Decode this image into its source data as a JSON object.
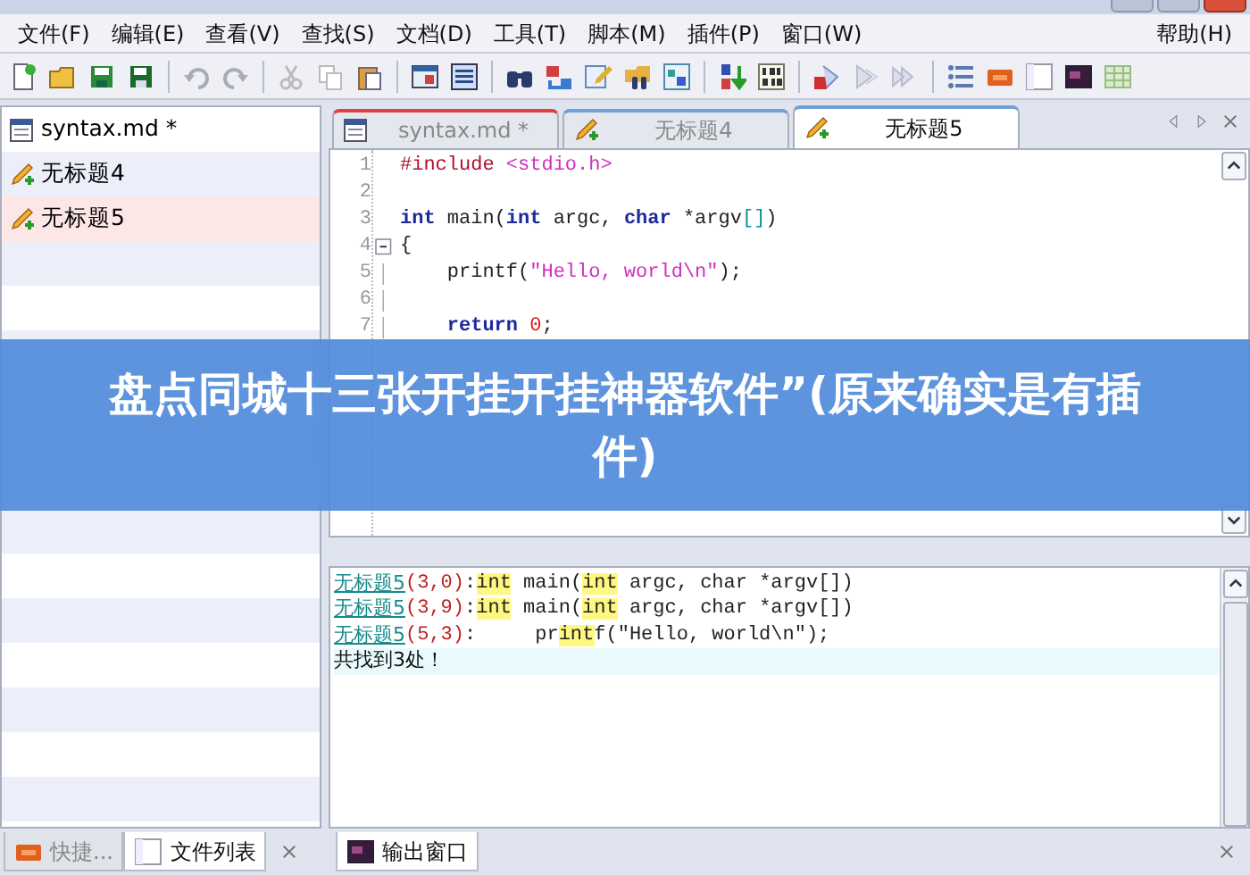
{
  "menu": [
    {
      "label": "文件(F)"
    },
    {
      "label": "编辑(E)"
    },
    {
      "label": "查看(V)"
    },
    {
      "label": "查找(S)"
    },
    {
      "label": "文档(D)"
    },
    {
      "label": "工具(T)"
    },
    {
      "label": "脚本(M)"
    },
    {
      "label": "插件(P)"
    },
    {
      "label": "窗口(W)"
    },
    {
      "label": "帮助(H)",
      "kind": "right"
    }
  ],
  "file_list": [
    {
      "label": "syntax.md *",
      "kind": "doc",
      "selected": false
    },
    {
      "label": "无标题4",
      "kind": "new",
      "selected": false
    },
    {
      "label": "无标题5",
      "kind": "new",
      "selected": true
    }
  ],
  "tabs": [
    {
      "label": "syntax.md *",
      "kind": "doc",
      "selected": false
    },
    {
      "label": "无标题4",
      "kind": "new",
      "selected": false
    },
    {
      "label": "无标题5",
      "kind": "new",
      "selected": true
    }
  ],
  "code_lines": [
    {
      "number": "1",
      "segments": [
        {
          "text": "#include ",
          "kind": "preproc"
        },
        {
          "text": "<stdio.h>",
          "kind": "string"
        }
      ]
    },
    {
      "number": "2"
    },
    {
      "number": "3",
      "segments": [
        {
          "text": "int",
          "kind": "keyword"
        },
        {
          "text": " main(",
          "kind": "plain"
        },
        {
          "text": "int",
          "kind": "keyword"
        },
        {
          "text": " argc, ",
          "kind": "plain"
        },
        {
          "text": "char",
          "kind": "keyword"
        },
        {
          "text": " *argv",
          "kind": "plain"
        },
        {
          "text": "[]",
          "kind": "bracket"
        },
        {
          "text": ")",
          "kind": "plain"
        }
      ]
    },
    {
      "number": "4",
      "kind": "fold_start",
      "segments": [
        {
          "text": "{",
          "kind": "plain"
        }
      ]
    },
    {
      "number": "5",
      "kind": "fold_inside",
      "segments": [
        {
          "text": "    printf(",
          "kind": "plain"
        },
        {
          "text": "\"Hello, world\\n\"",
          "kind": "string"
        },
        {
          "text": ");",
          "kind": "plain"
        }
      ]
    },
    {
      "number": "6",
      "kind": "fold_inside"
    },
    {
      "number": "7",
      "kind": "fold_inside",
      "segments": [
        {
          "text": "    return",
          "kind": "keyword"
        },
        {
          "text": " 0",
          "kind": "number"
        },
        {
          "text": ";",
          "kind": "plain"
        }
      ]
    }
  ],
  "output_lines": [
    {
      "kind": "match",
      "file": "无标题5",
      "position": "(3,0)",
      "segments": [
        {
          "text": ":",
          "kind": "plain"
        },
        {
          "text": "int",
          "kind": "match"
        },
        {
          "text": " main(",
          "kind": "plain"
        },
        {
          "text": "int",
          "kind": "match"
        },
        {
          "text": " argc, char *argv[])",
          "kind": "plain"
        }
      ]
    },
    {
      "kind": "match",
      "file": "无标题5",
      "position": "(3,9)",
      "segments": [
        {
          "text": ":",
          "kind": "plain"
        },
        {
          "text": "int",
          "kind": "match"
        },
        {
          "text": " main(",
          "kind": "plain"
        },
        {
          "text": "int",
          "kind": "match"
        },
        {
          "text": " argc, char *argv[])",
          "kind": "plain"
        }
      ]
    },
    {
      "kind": "match",
      "file": "无标题5",
      "position": "(5,3)",
      "segments": [
        {
          "text": ":     pr",
          "kind": "plain"
        },
        {
          "text": "int",
          "kind": "match"
        },
        {
          "text": "f(\"Hello, world\\n\");",
          "kind": "plain"
        }
      ]
    },
    {
      "kind": "summary",
      "text": "共找到3处！"
    }
  ],
  "bottom_tabs": [
    {
      "label": "快捷...",
      "selected": false,
      "disabled": true
    },
    {
      "label": "文件列表",
      "selected": true,
      "disabled": false
    }
  ],
  "output_tab": {
    "label": "输出窗口",
    "selected": true
  },
  "banner": {
    "text": "盘点同城十三张开挂开挂神器软件”(原来确实是有插件)"
  }
}
